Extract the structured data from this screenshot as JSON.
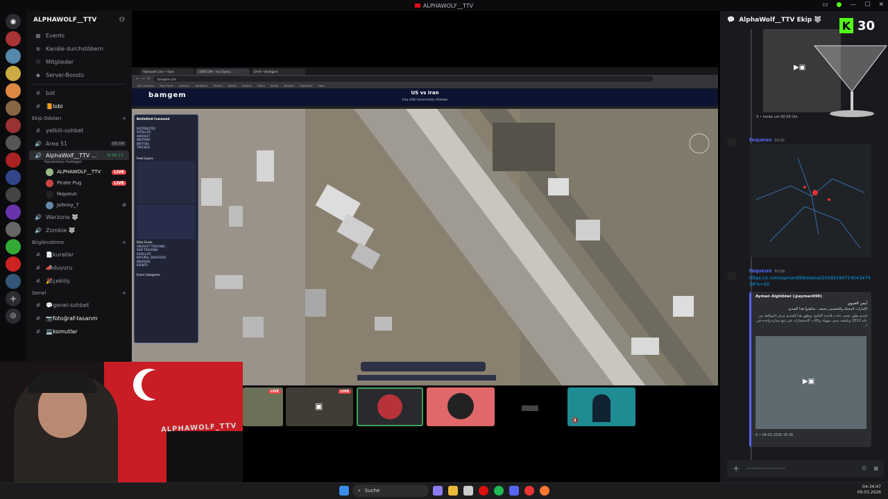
{
  "window": {
    "title": "ALPHAWOLF__TTV"
  },
  "server": {
    "name": "ALPHAWOLF__TTV"
  },
  "top_nav": [
    {
      "icon": "calendar-icon",
      "label": "Events"
    },
    {
      "icon": "compass-icon",
      "label": "Kanäle durchstöbern"
    },
    {
      "icon": "members-icon",
      "label": "Mitglieder"
    },
    {
      "icon": "boost-icon",
      "label": "Server-Boosts"
    }
  ],
  "text_channels_top": [
    {
      "label": "bot"
    },
    {
      "label": "📙lobi"
    }
  ],
  "category_voice": "Ekip Odaları",
  "voice_channels": [
    {
      "label": "yetkili-sohbet"
    },
    {
      "label": "Area 51",
      "count": "00",
      "limit": "04"
    },
    {
      "label": "AlphaWolf__TTV ...",
      "timer": "6:49:13",
      "status": "Kanalstatus festlegen"
    }
  ],
  "voice_users": [
    {
      "name": "ALPHAWOLF__TTV",
      "live": "LIVE"
    },
    {
      "name": "Pirate Pug",
      "live": "LIVE"
    },
    {
      "name": "fequeun",
      "live": ""
    },
    {
      "name": "Johnny_7",
      "live": ""
    }
  ],
  "voice_channels_2": [
    {
      "label": "Warzone 🐺"
    },
    {
      "label": "Zombie 🐺"
    }
  ],
  "category_info": "Bilgilendirme",
  "info_channels": [
    {
      "label": "📄kurallar"
    },
    {
      "label": "📣duyuru"
    },
    {
      "label": "🎉çekiliş"
    }
  ],
  "category_general": "Genel",
  "general_channels": [
    {
      "label": "💬genel-sohbet"
    },
    {
      "label": "📷fotoğraf-tasarım"
    },
    {
      "label": "💻komutlar"
    }
  ],
  "browser": {
    "tabs": [
      "Alphawolf_Live • Yayın",
      "CENTCOM • Iran Opera...",
      "Gh•E • Bamlgem"
    ],
    "url": "bamgem.com",
    "bookmarks": [
      "Kick Analytics",
      "Yayın Panel",
      "Haberler",
      "Tweetdeck",
      "Discord",
      "Spotify",
      "Youtube",
      "Twitch",
      "Reddit",
      "Weather",
      "Flightradar",
      "Maps"
    ]
  },
  "bamgem": {
    "logo": "bamgem",
    "title": "US vs Iran",
    "subtitle": "Iraq, Erbil Governorate, Ainkawa",
    "panel_title": "Battlefield Command",
    "panel_sections": [
      "DISTRIBUTED",
      "SATELLITE",
      "AIRCRAFT",
      "WEATHER",
      "ENTITIES",
      "TRACKED",
      "Feed Layers",
      "Data Feeds",
      "AIRCRAFT TRACKING",
      "SHIP TRACKING",
      "SATELLITE",
      "NATURAL DISASTERS",
      "WEATHER",
      "EVENTS",
      "Force Categories"
    ]
  },
  "webcam": {
    "overlay_name": "ALPHAWOLF_TTV"
  },
  "stream_thumbs": [
    {
      "live": "LIVE"
    },
    {
      "live": "LIVE"
    },
    {
      "live": ""
    },
    {
      "live": ""
    },
    {
      "live": ""
    },
    {
      "live": ""
    }
  ],
  "chat": {
    "header": "AlphaWolf__TTV Ekip 🐺",
    "kick_count": "30",
    "messages": [
      {
        "caption": "X • heute um 00:56 Uhr"
      },
      {
        "author": "fequeun",
        "time": "03:22"
      },
      {
        "author": "fequeun",
        "time": "03:59",
        "link": "https://x.com/ayman999/status/2029219471454347429?s=20",
        "embed_author": "Ayman Alghibiwi (@ayman999)",
        "embed_title": "أيمن الغبيوي",
        "embed_text": "الإمارات المحتلة والتحسس مخيف.. شاهدوا هذا الفيديو",
        "embed_body": "فيديو يظهر تفجير حادث قاعدة الخليج، وبظهر هذا الفيديو عرض الموافقة من عام 2012 وتكشف مدى سهولة وكالات الاستخبارات في تتبع سيارة واحدة في ا...",
        "embed_footer": "X • 04.03.2026 16:36"
      }
    ],
    "composer_placeholder": "----------------------"
  },
  "taskbar": {
    "search_label": "Suche",
    "time": "04:34:47",
    "date": "09.03.2026"
  },
  "colors": {
    "live": "#ed4245",
    "accent": "#5865f2",
    "kick": "#53fc18"
  }
}
